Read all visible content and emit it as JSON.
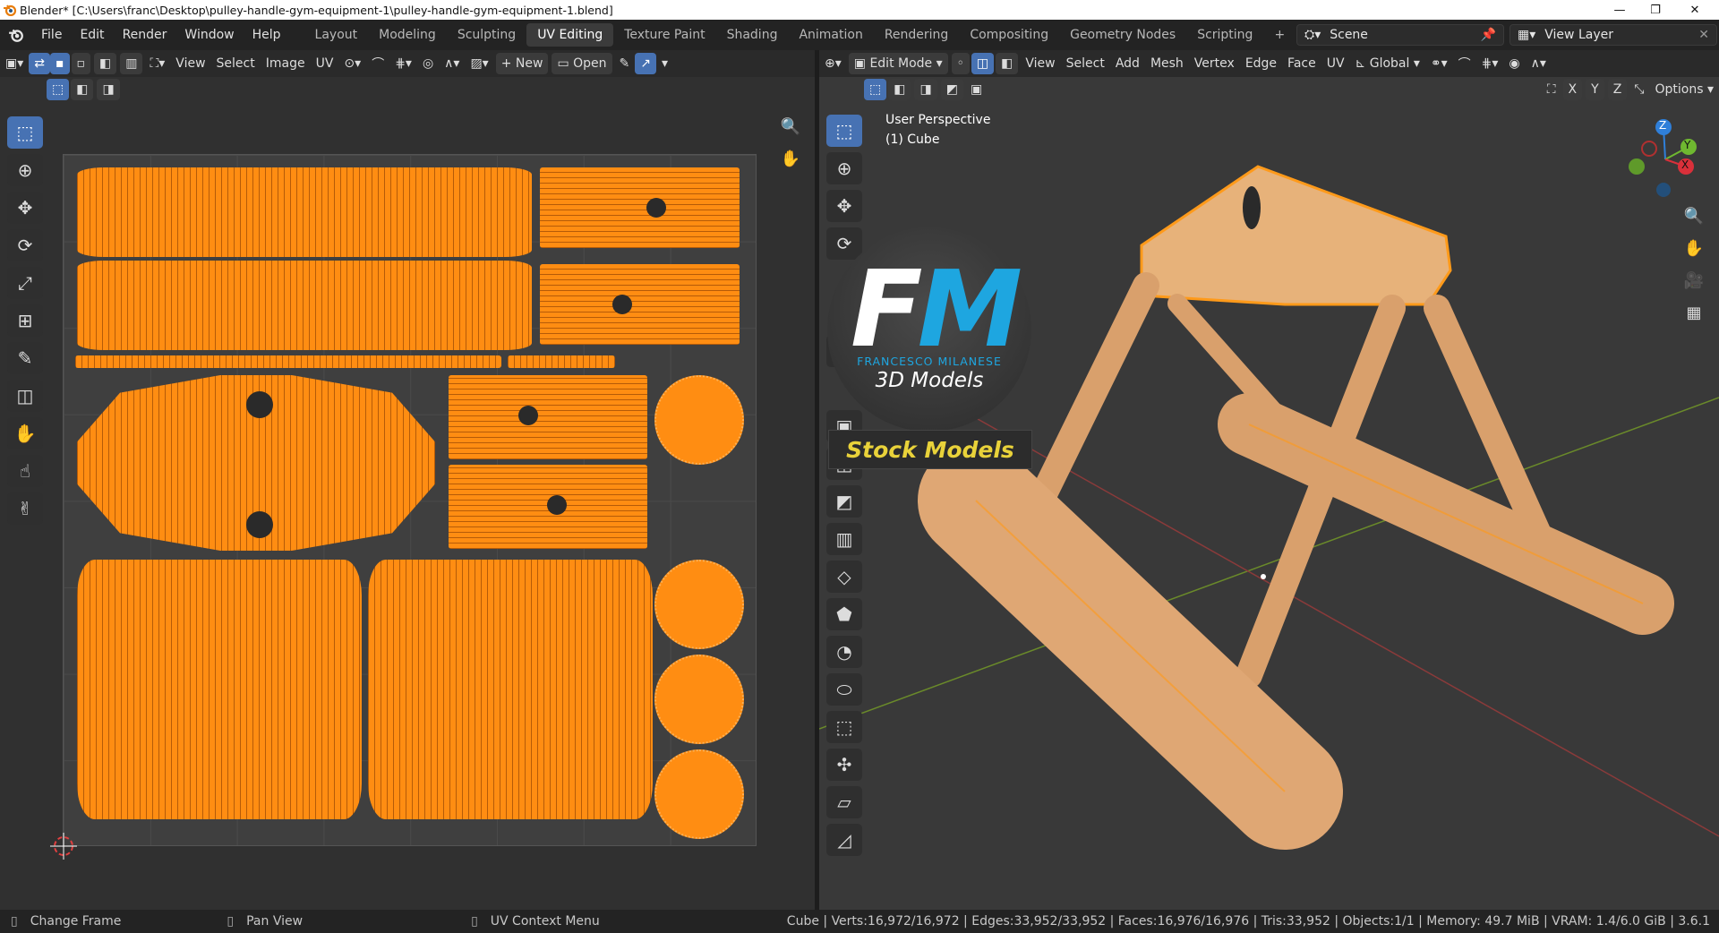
{
  "window": {
    "title": "Blender* [C:\\Users\\franc\\Desktop\\pulley-handle-gym-equipment-1\\pulley-handle-gym-equipment-1.blend]",
    "minimize": "—",
    "restore": "❐",
    "close": "✕"
  },
  "menu": [
    "File",
    "Edit",
    "Render",
    "Window",
    "Help"
  ],
  "workspaces": [
    "Layout",
    "Modeling",
    "Sculpting",
    "UV Editing",
    "Texture Paint",
    "Shading",
    "Animation",
    "Rendering",
    "Compositing",
    "Geometry Nodes",
    "Scripting"
  ],
  "active_workspace": "UV Editing",
  "add_workspace": "+",
  "scene": {
    "label": "Scene",
    "view_layer": "View Layer"
  },
  "uv_editor": {
    "menus": [
      "View",
      "Select",
      "Image",
      "UV"
    ],
    "new_label": "New",
    "open_label": "Open"
  },
  "viewport": {
    "mode": "Edit Mode",
    "menus": [
      "View",
      "Select",
      "Add",
      "Mesh",
      "Vertex",
      "Edge",
      "Face",
      "UV"
    ],
    "transform": "Global",
    "axes": [
      "X",
      "Y",
      "Z"
    ],
    "options": "Options",
    "perspective": "User Perspective",
    "object": "(1) Cube",
    "gizmo": {
      "z": "Z",
      "y": "Y",
      "x": "X"
    }
  },
  "watermark": {
    "letters_f": "F",
    "letters_m": "M",
    "name": "FRANCESCO MILANESE",
    "sub": "3D Models",
    "banner": "Stock Models"
  },
  "status": {
    "left": [
      {
        "icon": "mouse-left-icon",
        "label": "Change Frame"
      },
      {
        "icon": "mouse-middle-icon",
        "label": "Pan View"
      },
      {
        "icon": "mouse-right-icon",
        "label": "UV Context Menu"
      }
    ],
    "stats": "Cube | Verts:16,972/16,972 | Edges:33,952/33,952 | Faces:16,976/16,976 | Tris:33,952 | Objects:1/1 | Memory: 49.7 MiB | VRAM: 1.4/6.0 GiB | 3.6.1"
  },
  "colors": {
    "accent": "#4772b3",
    "uv_orange": "#ff8d12",
    "wm_yellow": "#e9d23a",
    "fm_blue": "#1ea6e0"
  }
}
